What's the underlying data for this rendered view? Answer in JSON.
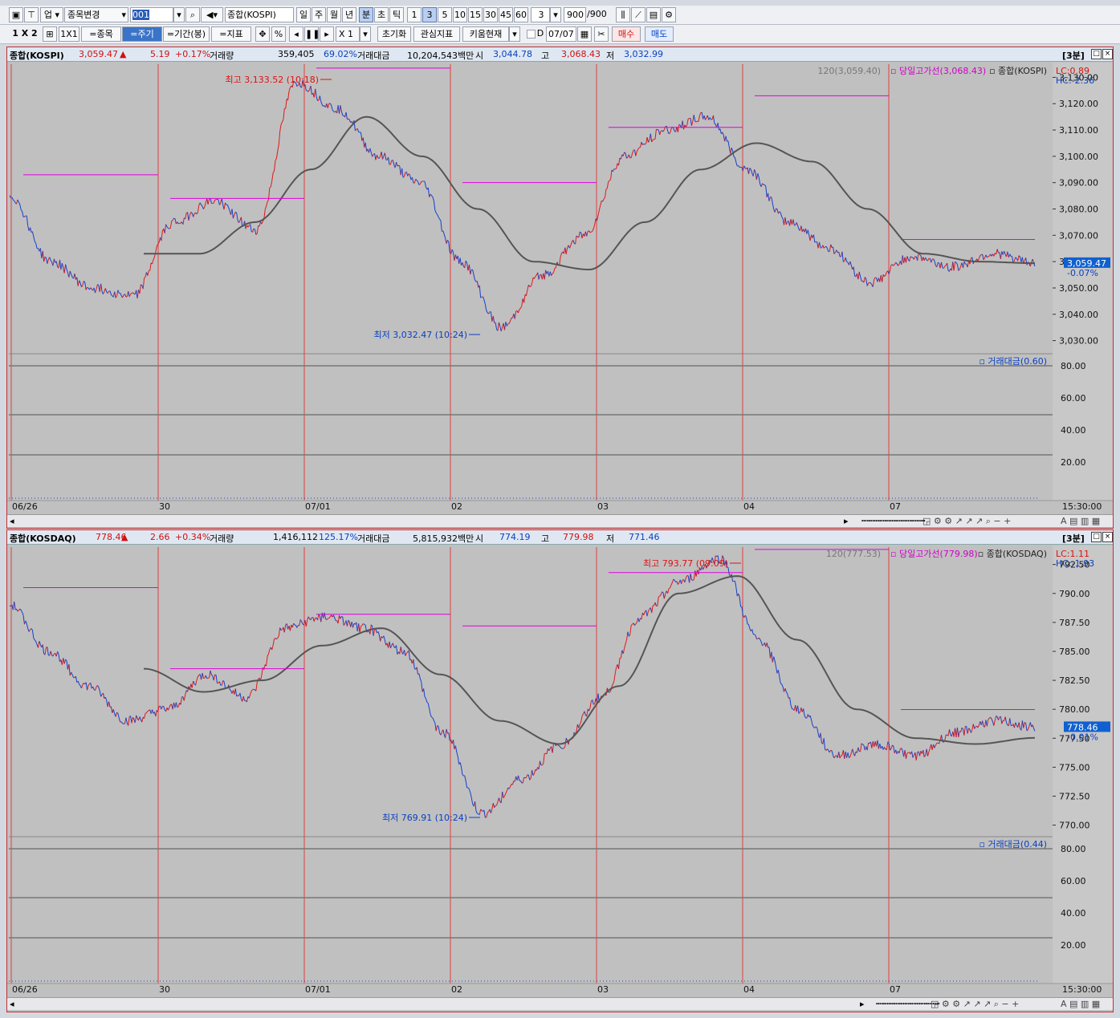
{
  "toolbar1": {
    "market": "업",
    "change_item": "종목변경",
    "code": "001",
    "name": "종합(KOSPI)",
    "periods": [
      "일",
      "주",
      "월",
      "년",
      "분",
      "초",
      "틱"
    ],
    "intervals": [
      "1",
      "3",
      "5",
      "10",
      "15",
      "30",
      "45",
      "60"
    ],
    "interval_value": "3",
    "count": "900",
    "count_total": "/900"
  },
  "toolbar2": {
    "layout": "1 X 2",
    "ratio": "1X1",
    "item_btn": "=종목",
    "period_btn": "=주기",
    "range_btn": "=기간(봉)",
    "indicator_btn": "=지표",
    "percent": "%",
    "zoom": "X 1",
    "reset": "초기화",
    "watch": "관심지표",
    "kiwoom": "키움현재",
    "d_label": "D",
    "date": "07/07",
    "buy": "매수",
    "sell": "매도"
  },
  "x_dates": [
    "06/26",
    "30",
    "07/01",
    "02",
    "03",
    "04",
    "07"
  ],
  "end_time": "15:30:00",
  "kospi": {
    "name": "종합(KOSPI)",
    "price": "3,059.47",
    "arrow": "▲",
    "change": "5.19",
    "change_pct": "+0.17%",
    "vol_label": "거래량",
    "volume": "359,405",
    "vol_pct": "69.02%",
    "amount_label": "거래대금",
    "amount": "10,204,543백만",
    "open_label": "시",
    "open": "3,044.78",
    "high_label": "고",
    "high": "3,068.43",
    "low_label": "저",
    "low": "3,032.99",
    "interval_tag": "[3분]",
    "legend_ma": "120(3,059.40)",
    "legend_high": "당일고가선(3,068.43)",
    "legend_name": "종합(KOSPI)",
    "lc": "LC:0.89",
    "hc": "HC:-2.36",
    "price_tag": "3,059.47",
    "pct_tag": "-0.07%",
    "max_label": "최고 3,133.52 (10:18)",
    "min_label": "최저 3,032.47 (10:24)",
    "vol_legend": "거래대금(0.60)",
    "y_ticks": [
      "3,130.00",
      "3,120.00",
      "3,110.00",
      "3,100.00",
      "3,090.00",
      "3,080.00",
      "3,070.00",
      "3,060.00",
      "3,050.00",
      "3,040.00",
      "3,030.00"
    ],
    "vol_ticks": [
      "80.00",
      "60.00",
      "40.00",
      "20.00"
    ]
  },
  "kosdaq": {
    "name": "종합(KOSDAQ)",
    "price": "778.46",
    "arrow": "▲",
    "change": "2.66",
    "change_pct": "+0.34%",
    "vol_label": "거래량",
    "volume": "1,416,112",
    "vol_pct": "125.17%",
    "amount_label": "거래대금",
    "amount": "5,815,932백만",
    "open_label": "시",
    "open": "774.19",
    "high_label": "고",
    "high": "779.98",
    "low_label": "저",
    "low": "771.46",
    "interval_tag": "[3분]",
    "legend_ma": "120(777.53)",
    "legend_high": "당일고가선(779.98)",
    "legend_name": "종합(KOSDAQ)",
    "lc": "LC:1.11",
    "hc": "HC:-1.93",
    "price_tag": "778.46",
    "pct_tag": "-0.01%",
    "max_label": "최고 793.77 (09:09)",
    "min_label": "최저 769.91 (10:24)",
    "vol_legend": "거래대금(0.44)",
    "y_ticks": [
      "792.50",
      "790.00",
      "787.50",
      "785.00",
      "782.50",
      "780.00",
      "777.50",
      "775.00",
      "772.50",
      "770.00"
    ],
    "vol_ticks": [
      "80.00",
      "60.00",
      "40.00",
      "20.00"
    ]
  },
  "chart_data": [
    {
      "type": "line",
      "title": "종합(KOSPI) 3분",
      "x": [
        "06/26",
        "30",
        "07/01",
        "02",
        "03",
        "04",
        "07"
      ],
      "ylim": [
        3025,
        3135
      ],
      "series": [
        {
          "name": "종합(KOSPI)",
          "values": [
            3085,
            3060,
            3050,
            3047,
            3075,
            3083,
            3072,
            3128,
            3118,
            3100,
            3090,
            3060,
            3035,
            3055,
            3070,
            3100,
            3110,
            3115,
            3095,
            3075,
            3065,
            3052,
            3062,
            3058,
            3063,
            3059.47
          ]
        },
        {
          "name": "120",
          "values": [
            3063,
            3063,
            3075,
            3095,
            3115,
            3100,
            3080,
            3060,
            3057,
            3075,
            3095,
            3105,
            3098,
            3080,
            3063,
            3060,
            3059.4
          ]
        }
      ]
    },
    {
      "type": "line",
      "title": "종합(KOSDAQ) 3분",
      "x": [
        "06/26",
        "30",
        "07/01",
        "02",
        "03",
        "04",
        "07"
      ],
      "ylim": [
        769,
        794
      ],
      "series": [
        {
          "name": "종합(KOSDAQ)",
          "values": [
            789,
            785,
            782,
            779,
            780,
            783,
            781,
            787,
            788,
            787,
            785,
            778,
            771,
            774,
            777,
            781,
            788,
            791,
            793,
            786,
            780,
            776,
            777,
            776,
            778,
            779,
            778.46
          ]
        },
        {
          "name": "120",
          "values": [
            783.5,
            781.5,
            782.5,
            785.5,
            787,
            783,
            779,
            777,
            782,
            790,
            791.5,
            786,
            780,
            777.5,
            777,
            777.53
          ]
        }
      ]
    }
  ]
}
